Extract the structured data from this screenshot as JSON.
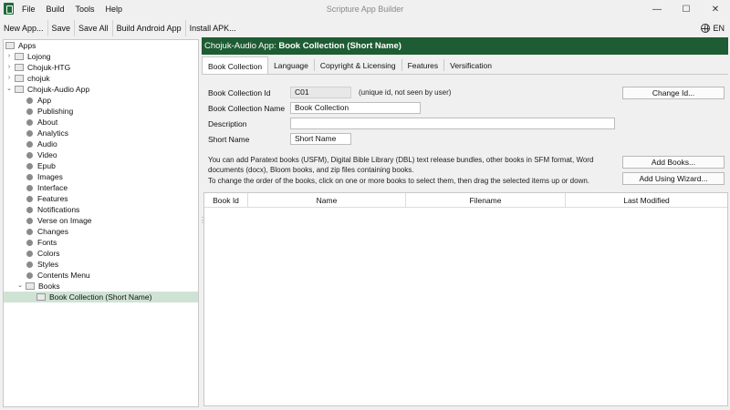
{
  "window": {
    "title": "Scripture App Builder",
    "menu": [
      "File",
      "Build",
      "Tools",
      "Help"
    ],
    "controls": [
      "—",
      "☐",
      "✕"
    ]
  },
  "toolbar": {
    "buttons": [
      "New App...",
      "Save",
      "Save All",
      "Build Android App",
      "Install APK..."
    ],
    "language": "EN"
  },
  "tree": {
    "root": "Apps",
    "items": [
      "Lojong",
      "Chojuk-HTG",
      "chojuk",
      "Chojuk-Audio App"
    ],
    "children": [
      "App",
      "Publishing",
      "About",
      "Analytics",
      "Audio",
      "Video",
      "Epub",
      "Images",
      "Interface",
      "Features",
      "Notifications",
      "Verse on Image",
      "Changes",
      "Fonts",
      "Colors",
      "Styles",
      "Contents Menu"
    ],
    "books_folder": "Books",
    "selected_item": "Book Collection (Short Name)"
  },
  "header": {
    "prefix": "Chojuk-Audio App: ",
    "title": "Book Collection (Short Name)"
  },
  "tabs": [
    "Book Collection",
    "Language",
    "Copyright & Licensing",
    "Features",
    "Versification"
  ],
  "form": {
    "id_label": "Book Collection Id",
    "id_value": "C01",
    "id_hint": "(unique id, not seen by user)",
    "change_id_button": "Change Id...",
    "name_label": "Book Collection Name",
    "name_value": "Book Collection",
    "description_label": "Description",
    "description_value": "",
    "short_name_label": "Short Name",
    "short_name_value": "Short Name"
  },
  "info": {
    "line1": "You can add Paratext books (USFM), Digital Bible Library (DBL) text release bundles, other books in SFM format, Word",
    "line2": "documents (docx), Bloom books, and zip files containing books.",
    "line3": "To change the order of the books, click on one or more books to select them, then drag the selected items up or down."
  },
  "buttons": {
    "add_books": "Add Books...",
    "add_wizard": "Add Using Wizard..."
  },
  "table": {
    "columns": [
      "Book Id",
      "Name",
      "Filename",
      "Last Modified"
    ]
  }
}
